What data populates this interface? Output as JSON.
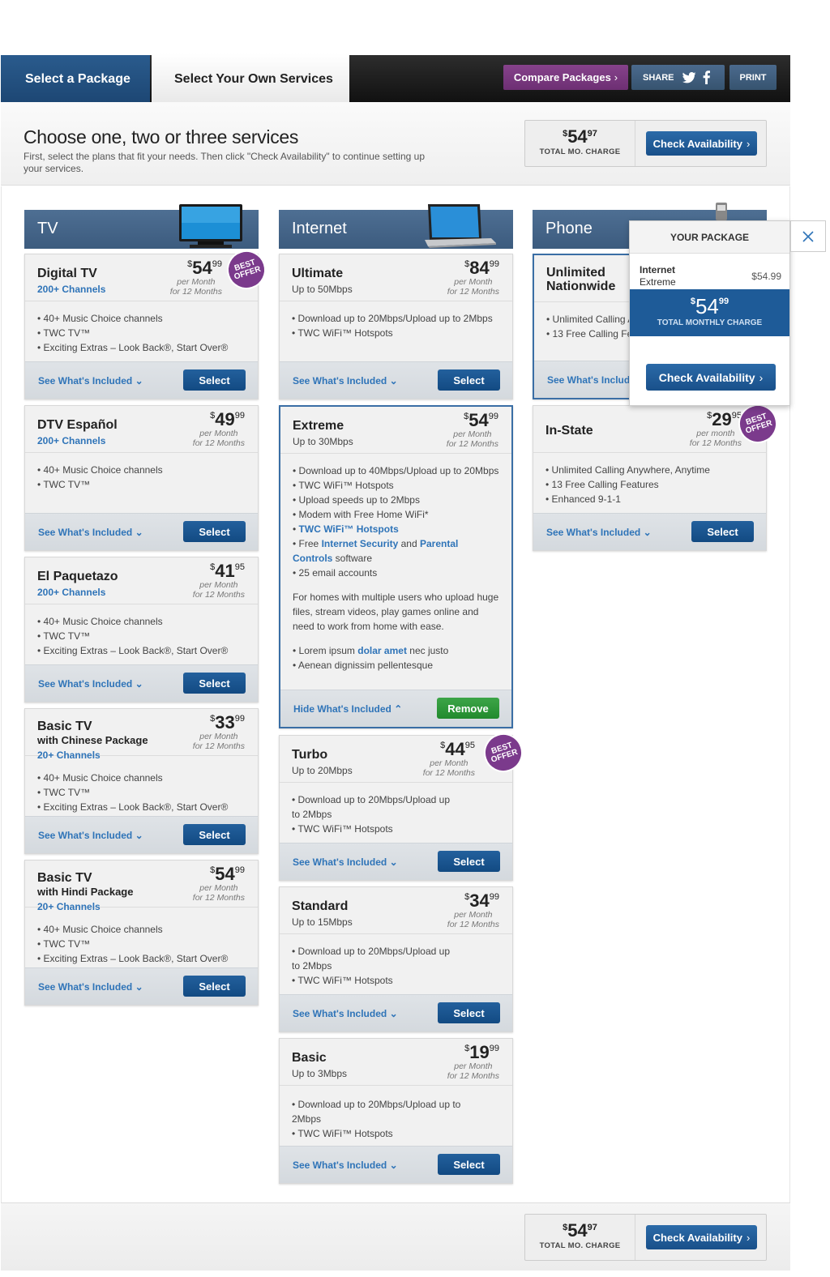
{
  "nav": {
    "tab_package": "Select a Package",
    "tab_own": "Select Your Own Services",
    "compare": "Compare Packages",
    "share": "SHARE",
    "print": "PRINT"
  },
  "header": {
    "title": "Choose one, two or three services",
    "subtitle": "First, select the plans that fit your needs. Then click \"Check Availability\" to continue setting up your services."
  },
  "summary": {
    "dollar": "$",
    "price_main": "54",
    "price_cents": "97",
    "label": "TOTAL MO. CHARGE",
    "check": "Check Availability"
  },
  "labels": {
    "see": "See What's Included",
    "hide": "Hide What's Included",
    "select": "Select",
    "remove": "Remove",
    "best_offer_1": "BEST",
    "best_offer_2": "OFFER",
    "per_month": "per Month",
    "per_month_lc": "per month",
    "for_12": "for 12 Months"
  },
  "columns": {
    "tv": "TV",
    "internet": "Internet",
    "phone": "Phone"
  },
  "tv": [
    {
      "name": "Digital TV",
      "sub": "200+ Channels",
      "dollars": "54",
      "cents": "99",
      "features": [
        "40+ Music Choice channels",
        "TWC TV™",
        "Exciting Extras – Look Back®, Start Over®"
      ]
    },
    {
      "name": "DTV Español",
      "sub": "200+ Channels",
      "dollars": "49",
      "cents": "99",
      "features": [
        "40+ Music Choice channels",
        "TWC TV™"
      ]
    },
    {
      "name": "El Paquetazo",
      "sub": "200+ Channels",
      "dollars": "41",
      "cents": "95",
      "features": [
        "40+ Music Choice channels",
        "TWC TV™",
        "Exciting Extras – Look Back®, Start Over®"
      ]
    },
    {
      "name": "Basic TV",
      "small": "with Chinese Package",
      "sub": "20+ Channels",
      "dollars": "33",
      "cents": "99",
      "features": [
        "40+ Music Choice channels",
        "TWC TV™",
        "Exciting Extras – Look Back®, Start Over®"
      ]
    },
    {
      "name": "Basic TV",
      "small": "with Hindi Package",
      "sub": "20+ Channels",
      "dollars": "54",
      "cents": "99",
      "features": [
        "40+ Music Choice channels",
        "TWC TV™",
        "Exciting Extras – Look Back®, Start Over®"
      ]
    }
  ],
  "internet": [
    {
      "name": "Ultimate",
      "sub": "Up to 50Mbps",
      "dollars": "84",
      "cents": "99",
      "features": [
        "Download up to 20Mbps/Upload up to 2Mbps",
        "TWC WiFi™ Hotspots"
      ]
    },
    {
      "name": "Extreme",
      "sub": "Up to 30Mbps",
      "dollars": "54",
      "cents": "99",
      "features": [
        "Download up to 40Mbps/Upload up to 20Mbps",
        "TWC WiFi™ Hotspots",
        "Upload speeds up to 2Mbps",
        "Modem with Free Home WiFi*"
      ],
      "hotspots_link": "TWC WiFi™ Hotspots",
      "free_1": "Free ",
      "security_link": "Internet Security",
      "free_and": " and ",
      "parental_link": "Parental Controls",
      "free_2": " software",
      "email": "25 email accounts",
      "para": "For homes with multiple users who upload huge files, stream videos, play games online and need to work from home with ease.",
      "lorem_1": "Lorem ipsum ",
      "lorem_link": "dolar amet",
      "lorem_2": " nec justo",
      "aenean": "Aenean dignissim pellentesque"
    },
    {
      "name": "Turbo",
      "sub": "Up to 20Mbps",
      "dollars": "44",
      "cents": "95",
      "features": [
        "Download up to 20Mbps/Upload up to 2Mbps",
        "TWC WiFi™ Hotspots"
      ]
    },
    {
      "name": "Standard",
      "sub": "Up to 15Mbps",
      "dollars": "34",
      "cents": "99",
      "features": [
        "Download up to 20Mbps/Upload up to 2Mbps",
        "TWC WiFi™ Hotspots"
      ]
    },
    {
      "name": "Basic",
      "sub": "Up to 3Mbps",
      "dollars": "19",
      "cents": "99",
      "features": [
        "Download up to 20Mbps/Upload up to 2Mbps",
        "TWC WiFi™ Hotspots"
      ]
    }
  ],
  "phone": [
    {
      "name_1": "Unlimited",
      "name_2": "Nationwide",
      "features": [
        "Unlimited Calling A",
        "13 Free Calling Fe"
      ],
      "see": "See What's Includ"
    },
    {
      "name": "In-State",
      "dollars": "29",
      "cents": "95",
      "features": [
        "Unlimited Calling Anywhere, Anytime",
        "13 Free Calling Features",
        "Enhanced 9-1-1"
      ]
    }
  ],
  "package": {
    "title": "YOUR PACKAGE",
    "item_name": "Internet",
    "item_plan": "Extreme",
    "item_price": "$54.99",
    "dollar": "$",
    "total_main": "54",
    "total_cents": "99",
    "total_label": "TOTAL MONTHLY CHARGE",
    "check": "Check Availability"
  },
  "colors": {
    "nav_blue": "#1d4774",
    "compare_purple": "#86428b",
    "column_header": "#4e6f93",
    "link_blue": "#2f74b8",
    "select_blue": "#124a82",
    "remove_green": "#3da548",
    "best_offer_purple": "#7b3a8c"
  }
}
